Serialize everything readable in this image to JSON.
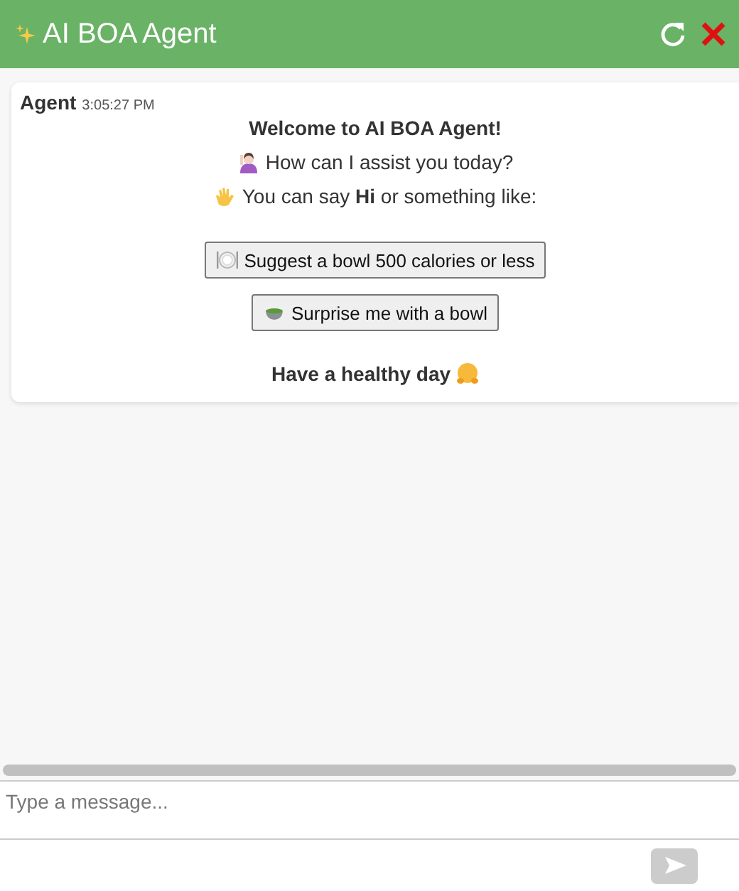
{
  "header": {
    "title": "AI BOA Agent"
  },
  "messages": [
    {
      "sender": "Agent",
      "time": "3:05:27 PM",
      "heading": "Welcome to AI BOA Agent!",
      "lines": [
        {
          "kind": "greeting",
          "text": "How can I assist you today?"
        },
        {
          "kind": "wave",
          "text": "You can say **Hi** or something like:"
        }
      ],
      "suggestions": [
        {
          "kind": "plate",
          "label": "Suggest a bowl 500 calories or less"
        },
        {
          "kind": "bowl",
          "label": "Surprise me with a bowl"
        }
      ],
      "closing": "Have a healthy day"
    }
  ],
  "composer": {
    "placeholder": "Type a message...",
    "send_disabled": true
  }
}
